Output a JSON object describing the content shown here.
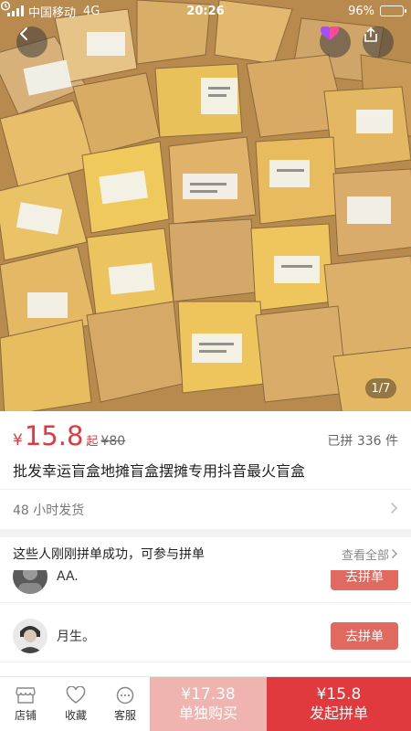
{
  "status_bar": {
    "carrier": "中国移动",
    "network": "4G",
    "time": "20:26",
    "battery": "96%",
    "battery_level": 0.96
  },
  "gallery": {
    "indicator": "1/7"
  },
  "price": {
    "currency": "¥",
    "value": "15.8",
    "suffix": "起",
    "original": "¥80",
    "sold": "已拼 336 件"
  },
  "product": {
    "title": "批发幸运盲盒地摊盲盒摆摊专用抖音最火盲盒"
  },
  "shipping": {
    "text": "48 小时发货"
  },
  "group": {
    "heading": "这些人刚刚拼单成功，可参与拼单",
    "view_all": "查看全部",
    "items": [
      {
        "name": "AA.",
        "button": "去拼单"
      },
      {
        "name": "月生。",
        "button": "去拼单"
      }
    ]
  },
  "bottom_bar": {
    "store": "店铺",
    "favorite": "收藏",
    "service": "客服",
    "alone_price": "¥17.38",
    "alone_label": "单独购买",
    "group_price": "¥15.8",
    "group_label": "发起拼单"
  },
  "colors": {
    "accent": "#e0393e",
    "join_button": "#e06a5f",
    "alone_button": "#f0b4b0"
  }
}
